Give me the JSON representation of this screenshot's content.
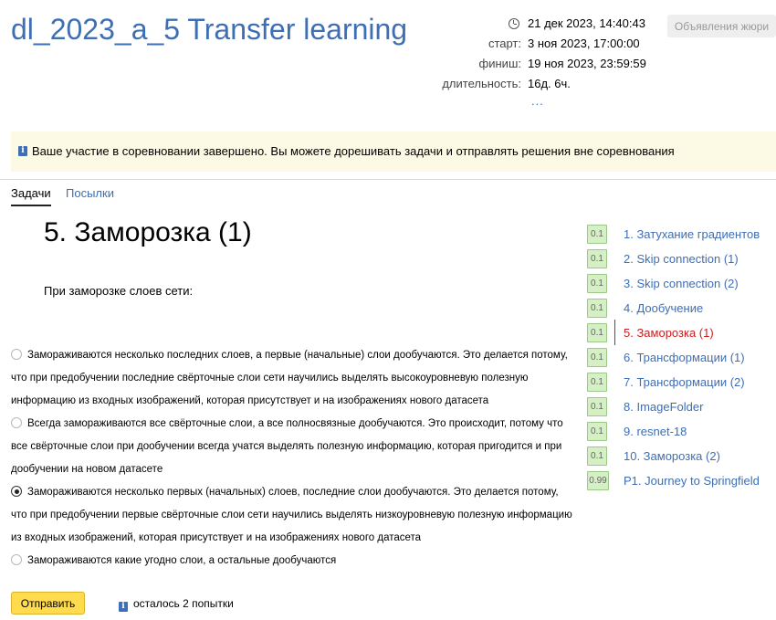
{
  "contest": {
    "title": "dl_2023_a_5 Transfer learning",
    "current_time": "21 дек 2023, 14:40:43",
    "start_label": "старт:",
    "start_value": "3 ноя 2023, 17:00:00",
    "finish_label": "финиш:",
    "finish_value": "19 ноя 2023, 23:59:59",
    "duration_label": "длительность:",
    "duration_value": "16д. 6ч.",
    "more_link": "...",
    "jury_button": "Объявления жюри"
  },
  "notice": {
    "icon": "info-icon",
    "text": "Ваше участие в соревновании завершено. Вы можете дорешивать задачи и отправлять решения вне соревнования"
  },
  "tabs": [
    {
      "label": "Задачи",
      "active": true
    },
    {
      "label": "Посылки",
      "active": false
    }
  ],
  "problem": {
    "title": "5. Заморозка (1)",
    "question": "При заморозке слоев сети:",
    "options": [
      {
        "text": "Замораживаются несколько последних слоев, а первые (начальные) слои дообучаются. Это делается потому, что при предобучении последние свёрточные слои сети научились выделять высокоуровневую полезную информацию из входных изображений, которая присутствует и на изображениях нового датасета",
        "checked": false
      },
      {
        "text": "Всегда замораживаются все свёрточные слои, а все полносвязные дообучаются. Это происходит, потому что все свёрточные слои при дообучении всегда учатся выделять полезную информацию, которая пригодится и при дообучении на новом датасете",
        "checked": false
      },
      {
        "text": "Замораживаются несколько первых (начальных) слоев, последние слои дообучаются. Это делается потому, что при предобучении первые свёрточные слои сети научились выделять низкоуровневую полезную информацию из входных изображений, которая присутствует и на изображениях нового датасета",
        "checked": true
      },
      {
        "text": "Замораживаются какие угодно слои, а остальные дообучаются",
        "checked": false
      }
    ],
    "submit_label": "Отправить",
    "attempts_text": "осталось 2 попытки"
  },
  "sidebar": {
    "items": [
      {
        "score": "0.1",
        "label": "1. Затухание градиентов",
        "active": false
      },
      {
        "score": "0.1",
        "label": "2. Skip connection (1)",
        "active": false
      },
      {
        "score": "0.1",
        "label": "3. Skip connection (2)",
        "active": false
      },
      {
        "score": "0.1",
        "label": "4. Дообучение",
        "active": false
      },
      {
        "score": "0.1",
        "label": "5. Заморозка (1)",
        "active": true
      },
      {
        "score": "0.1",
        "label": "6. Трансформации (1)",
        "active": false
      },
      {
        "score": "0.1",
        "label": "7. Трансформации (2)",
        "active": false
      },
      {
        "score": "0.1",
        "label": "8. ImageFolder",
        "active": false
      },
      {
        "score": "0.1",
        "label": "9. resnet-18",
        "active": false
      },
      {
        "score": "0.1",
        "label": "10. Заморозка (2)",
        "active": false
      },
      {
        "score": "0.99",
        "label": "P1. Journey to Springfield",
        "active": false
      }
    ]
  }
}
